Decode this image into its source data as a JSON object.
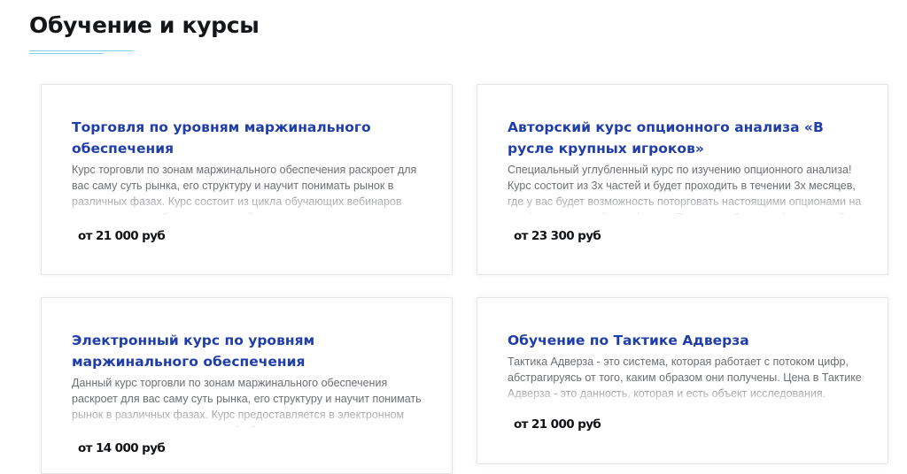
{
  "section": {
    "title": "Обучение и курсы"
  },
  "courses": [
    {
      "title": "Торговля по уровням маржинального обеспечения",
      "description": "Курс торговли по зонам маржинального обеспечения раскроет для вас саму суть рынка, его структуру и научит понимать рынок в различных фазах. Курс состоит из цикла обучающих вебинаров включающих в себя максимальный охват различных ресурсов и факторов",
      "price": "от 21 000 руб"
    },
    {
      "title": "Авторский курс опционного анализа «В русле крупных игроков»",
      "description": "Специальный углубленный курс по изучению опционного анализа! Курс состоит из 3х частей и будет проходить в течении 3х месяцев, где у вас будет возможность поторговать настоящими опционами на профессиональной платформе. Проводит обучение финансовый",
      "price": "от 23 300 руб"
    },
    {
      "title": "Электронный курс по уровням маржинального обеспечения",
      "description": "Данный курс торговли по зонам маржинального обеспечения раскроет для вас саму суть рынка, его структуру и научит понимать рынок в различных фазах. Курс предоставляется в электронном виде и состоит из цикла записей обучающих уроков, включающих в себя",
      "price": "от 14 000 руб"
    },
    {
      "title": "Обучение по Тактике Адверза",
      "description": "Тактика Адверза - это система, которая работает с потоком цифр, абстрагируясь от того, каким образом они получены. Цена в Тактике Адверза - это данность, которая и есть объект исследования.",
      "price": "от 21 000 руб"
    }
  ]
}
